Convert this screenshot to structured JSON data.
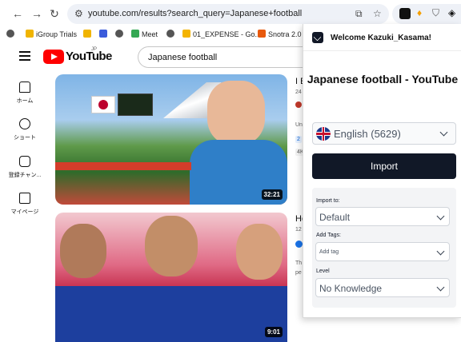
{
  "browser": {
    "url": "youtube.com/results?search_query=Japanese+football",
    "bookmarks": [
      {
        "label": "iGroup Trials",
        "color": "#f0b400"
      },
      {
        "label": "",
        "color": "#f0b400"
      },
      {
        "label": "",
        "color": "#3b5bdb"
      },
      {
        "label": "",
        "color": "#555555"
      },
      {
        "label": "Meet",
        "color": "#34a853"
      },
      {
        "label": "",
        "color": "#555555"
      },
      {
        "label": "01_EXPENSE - Go...",
        "color": "#f4b400"
      },
      {
        "label": "Snotra 2.0",
        "color": "#e8590c"
      }
    ]
  },
  "youtube": {
    "logo_text": "YouTube",
    "logo_region": "JP",
    "search_value": "Japanese football",
    "guide": [
      {
        "label": "ホーム",
        "icon": "home-icon"
      },
      {
        "label": "ショート",
        "icon": "shorts-icon"
      },
      {
        "label": "登録チャン...",
        "icon": "subscriptions-icon"
      },
      {
        "label": "マイページ",
        "icon": "library-icon"
      }
    ],
    "videos": [
      {
        "title": "I E",
        "meta1": "24",
        "meta2": "Un",
        "badge": "2",
        "badge2": "4K",
        "duration": "32:21"
      },
      {
        "title": "Ho",
        "meta1": "12",
        "meta2": "Th",
        "meta3": "pe",
        "badge": "",
        "badge2": "",
        "duration": "9:01"
      }
    ]
  },
  "popup": {
    "welcome": "Welcome Kazuki_Kasama!",
    "title": "Japanese football - YouTube",
    "language": "English (5629)",
    "import_label": "Import",
    "import_to_label": "Import to:",
    "import_to_value": "Default",
    "tags_label": "Add Tags:",
    "tags_placeholder": "Add tag",
    "level_label": "Level",
    "level_value": "No Knowledge"
  }
}
